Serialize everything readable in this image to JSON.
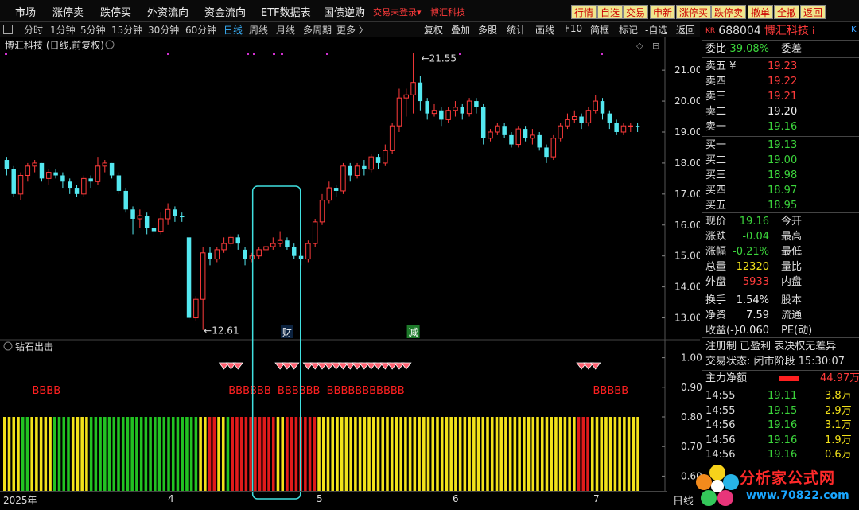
{
  "menu": [
    "市场",
    "涨停卖",
    "跌停买",
    "外资流向",
    "资金流向",
    "ETF数据表",
    "国债逆购"
  ],
  "menu_red": [
    "交易未登录",
    "博汇科技"
  ],
  "top_buttons": [
    "行情",
    "自选",
    "交易",
    "申新",
    "涨停买",
    "跌停卖",
    "撤单",
    "全撤",
    "返回"
  ],
  "periods": [
    "分时",
    "1分钟",
    "5分钟",
    "15分钟",
    "30分钟",
    "60分钟",
    "日线",
    "周线",
    "月线",
    "多周期",
    "更多 〉"
  ],
  "active_period": "日线",
  "tools": [
    "复权",
    "叠加",
    "多股",
    "统计",
    "画线",
    "F10",
    "简框",
    "标记",
    "-自选",
    "返回"
  ],
  "chart_title": "博汇科技 (日线,前复权)",
  "indicator_title": "钻石出击",
  "stock": {
    "kr": "KR",
    "code": "688004",
    "name": "博汇科技",
    "suffix": "i",
    "k": "K"
  },
  "weibi": {
    "label": "委比",
    "value": "-39.08%",
    "right": "委差"
  },
  "asks": [
    {
      "label": "卖五 ¥",
      "price": "19.23"
    },
    {
      "label": "卖四",
      "price": "19.22"
    },
    {
      "label": "卖三",
      "price": "19.21"
    },
    {
      "label": "卖二",
      "price": "19.20"
    },
    {
      "label": "卖一",
      "price": "19.16"
    }
  ],
  "bids": [
    {
      "label": "买一",
      "price": "19.13"
    },
    {
      "label": "买二",
      "price": "19.00"
    },
    {
      "label": "买三",
      "price": "18.98"
    },
    {
      "label": "买四",
      "price": "18.97"
    },
    {
      "label": "买五",
      "price": "18.95"
    }
  ],
  "quote": [
    {
      "label": "现价",
      "value": "19.16",
      "right": "今开",
      "color": "green"
    },
    {
      "label": "涨跌",
      "value": "-0.04",
      "right": "最高",
      "color": "green"
    },
    {
      "label": "涨幅",
      "value": "-0.21%",
      "right": "最低",
      "color": "green"
    },
    {
      "label": "总量",
      "value": "12320",
      "right": "量比",
      "color": "yellow"
    },
    {
      "label": "外盘",
      "value": "5933",
      "right": "内盘",
      "color": "red"
    },
    {
      "label": "换手",
      "value": "1.54%",
      "right": "股本",
      "color": "white"
    },
    {
      "label": "净资",
      "value": "7.59",
      "right": "流通",
      "color": "white"
    },
    {
      "label": "收益(-)",
      "value": "-0.060",
      "right": "PE(动)",
      "color": "white"
    }
  ],
  "tags": "注册制 已盈利 表决权无差异",
  "trade_status": "交易状态: 闭市阶段 15:30:07",
  "main_flow": {
    "label": "主力净额",
    "value": "44.97万"
  },
  "ticks": [
    {
      "time": "14:55",
      "price": "19.11",
      "vol": "3.8万"
    },
    {
      "time": "14:55",
      "price": "19.15",
      "vol": "2.9万"
    },
    {
      "time": "14:56",
      "price": "19.16",
      "vol": "3.1万"
    },
    {
      "time": "14:56",
      "price": "19.16",
      "vol": "1.9万"
    },
    {
      "time": "14:56",
      "price": "19.16",
      "vol": "0.6万"
    }
  ],
  "watermark": {
    "text": "分析家公式网",
    "url": "www.70822.com"
  },
  "bottom_right": "日线",
  "price_axis": [
    "21.00",
    "20.00",
    "19.00",
    "18.00",
    "17.00",
    "16.00",
    "15.00",
    "14.00",
    "13.00"
  ],
  "ind_axis": [
    "1.00",
    "0.90",
    "0.80",
    "0.70",
    "0.60"
  ],
  "x_ticks": [
    "2025年",
    "4",
    "5",
    "6",
    "7"
  ],
  "annotations": {
    "high": "21.55",
    "low": "12.61",
    "cai": "财",
    "jian": "减"
  },
  "bbbb_groups": [
    "BBBB",
    "BBBBBB",
    "BBBBBB",
    "BBBBBBBBBBB",
    "BBBBB"
  ],
  "colors": {
    "up": "#ff3b3b",
    "down": "#54e8f0",
    "bar_green": "#22c322",
    "bar_red": "#e01b1b",
    "bar_yellow": "#f2e21a",
    "highlight": "#40e0e0"
  },
  "chart_data": {
    "type": "candlestick",
    "y_range": [
      12.5,
      21.8
    ],
    "high_label": 21.55,
    "low_label": 12.61,
    "candles": [
      [
        18.1,
        17.8,
        18.2,
        17.6
      ],
      [
        17.8,
        17.0,
        17.9,
        16.9
      ],
      [
        17.0,
        17.6,
        17.7,
        16.8
      ],
      [
        17.6,
        17.9,
        18.0,
        17.4
      ],
      [
        17.9,
        18.0,
        18.1,
        17.7
      ],
      [
        18.0,
        17.5,
        18.0,
        17.4
      ],
      [
        17.5,
        17.7,
        17.8,
        17.3
      ],
      [
        17.7,
        17.6,
        17.8,
        17.5
      ],
      [
        17.6,
        17.4,
        17.7,
        17.2
      ],
      [
        17.4,
        17.2,
        17.5,
        17.0
      ],
      [
        17.2,
        17.0,
        17.3,
        16.9
      ],
      [
        17.0,
        17.5,
        17.6,
        16.9
      ],
      [
        17.5,
        17.4,
        17.6,
        17.2
      ],
      [
        17.4,
        17.9,
        18.2,
        17.3
      ],
      [
        17.9,
        18.0,
        18.1,
        17.7
      ],
      [
        18.0,
        17.6,
        18.0,
        17.5
      ],
      [
        17.6,
        17.1,
        17.7,
        17.0
      ],
      [
        17.1,
        16.5,
        17.2,
        16.4
      ],
      [
        16.5,
        16.2,
        16.6,
        15.7
      ],
      [
        16.2,
        16.3,
        16.5,
        15.9
      ],
      [
        16.3,
        15.9,
        16.4,
        15.7
      ],
      [
        15.9,
        15.8,
        16.0,
        15.6
      ],
      [
        15.8,
        16.2,
        16.4,
        15.7
      ],
      [
        16.2,
        16.5,
        16.7,
        16.0
      ],
      [
        16.5,
        16.3,
        16.6,
        16.1
      ],
      [
        16.3,
        16.25,
        16.4,
        16.1
      ],
      [
        15.6,
        13.0,
        15.6,
        12.95
      ],
      [
        13.0,
        13.6,
        13.7,
        12.9
      ],
      [
        13.6,
        15.1,
        15.3,
        12.61
      ],
      [
        15.1,
        14.9,
        15.3,
        14.7
      ],
      [
        14.9,
        15.2,
        15.3,
        14.8
      ],
      [
        15.2,
        15.4,
        15.6,
        15.1
      ],
      [
        15.4,
        15.6,
        15.7,
        15.3
      ],
      [
        15.6,
        15.4,
        15.7,
        15.2
      ],
      [
        15.2,
        14.9,
        15.3,
        14.7
      ],
      [
        14.9,
        15.0,
        15.1,
        14.8
      ],
      [
        15.0,
        15.2,
        15.3,
        14.9
      ],
      [
        15.2,
        15.3,
        15.5,
        15.1
      ],
      [
        15.3,
        15.4,
        15.6,
        15.2
      ],
      [
        15.4,
        15.5,
        15.8,
        15.3
      ],
      [
        15.5,
        15.3,
        15.6,
        15.2
      ],
      [
        15.3,
        15.0,
        15.4,
        14.9
      ],
      [
        15.0,
        14.9,
        15.1,
        14.7
      ],
      [
        14.9,
        15.4,
        15.5,
        14.8
      ],
      [
        15.4,
        16.1,
        16.2,
        15.3
      ],
      [
        16.1,
        16.8,
        17.0,
        16.0
      ],
      [
        16.8,
        17.2,
        17.4,
        16.7
      ],
      [
        17.2,
        17.1,
        17.3,
        16.9
      ],
      [
        17.1,
        17.9,
        18.0,
        17.0
      ],
      [
        17.9,
        17.6,
        18.0,
        17.4
      ],
      [
        17.6,
        17.9,
        18.0,
        17.5
      ],
      [
        17.9,
        17.8,
        18.1,
        17.6
      ],
      [
        17.8,
        18.2,
        18.3,
        17.7
      ],
      [
        18.2,
        18.0,
        18.3,
        17.8
      ],
      [
        18.0,
        18.4,
        18.6,
        17.9
      ],
      [
        18.4,
        19.2,
        19.3,
        18.3
      ],
      [
        19.2,
        20.1,
        20.4,
        19.0
      ],
      [
        20.1,
        20.2,
        20.4,
        19.5
      ],
      [
        20.2,
        20.6,
        21.55,
        19.6
      ],
      [
        20.6,
        20.0,
        20.8,
        19.7
      ],
      [
        20.0,
        19.6,
        20.1,
        19.4
      ],
      [
        19.6,
        19.7,
        19.9,
        19.5
      ],
      [
        19.7,
        19.4,
        19.8,
        19.2
      ],
      [
        19.4,
        19.7,
        19.8,
        19.3
      ],
      [
        19.7,
        19.8,
        20.0,
        19.5
      ],
      [
        19.8,
        19.6,
        19.9,
        19.4
      ],
      [
        19.6,
        20.0,
        20.1,
        19.5
      ],
      [
        20.0,
        19.8,
        20.1,
        19.6
      ],
      [
        19.8,
        18.8,
        19.9,
        18.6
      ],
      [
        18.8,
        19.0,
        19.1,
        18.7
      ],
      [
        19.0,
        19.2,
        19.3,
        18.9
      ],
      [
        19.2,
        18.9,
        19.3,
        18.8
      ],
      [
        18.9,
        18.6,
        19.0,
        18.5
      ],
      [
        18.6,
        19.1,
        19.2,
        18.5
      ],
      [
        19.1,
        18.8,
        19.2,
        18.7
      ],
      [
        18.8,
        18.9,
        19.1,
        18.6
      ],
      [
        18.9,
        18.5,
        19.0,
        18.4
      ],
      [
        18.5,
        18.2,
        18.6,
        18.0
      ],
      [
        18.2,
        18.8,
        18.9,
        18.1
      ],
      [
        18.8,
        19.2,
        19.3,
        18.7
      ],
      [
        19.2,
        19.4,
        19.6,
        19.1
      ],
      [
        19.4,
        19.5,
        19.7,
        19.3
      ],
      [
        19.5,
        19.3,
        19.6,
        19.1
      ],
      [
        19.3,
        19.7,
        19.8,
        19.2
      ],
      [
        19.7,
        20.0,
        20.2,
        19.6
      ],
      [
        20.0,
        19.6,
        20.1,
        19.4
      ],
      [
        19.6,
        19.3,
        19.7,
        19.1
      ],
      [
        19.3,
        19.0,
        19.4,
        18.9
      ],
      [
        19.0,
        19.2,
        19.3,
        18.9
      ],
      [
        19.2,
        19.2,
        19.3,
        19.0
      ],
      [
        19.2,
        19.16,
        19.3,
        19.0
      ]
    ],
    "cai_index": 40,
    "jian_index": 58,
    "highlight_range": [
      36,
      41
    ],
    "diamond_groups": [
      [
        31,
        33
      ],
      [
        39,
        41
      ],
      [
        43,
        50
      ],
      [
        51,
        57
      ],
      [
        82,
        84
      ]
    ],
    "bbbb_positions": [
      5,
      33,
      40,
      47,
      85
    ],
    "bar_colors": "YYYYGGYYYYYGGGGYYYYGGGGGGGGGGGGGGGGGGGGGGGGYYRRYYGRRRRRRRRRRYYRRRRRRRYYYYYYYYYYYYYYYYYYYYYYYYYYYYYYYYYYYYYYYYYYYYYYYYYYYYYYYYYRRRYYYYYYYYYYY",
    "bar_level": 0.8,
    "ind_range": [
      0.55,
      1.05
    ]
  }
}
